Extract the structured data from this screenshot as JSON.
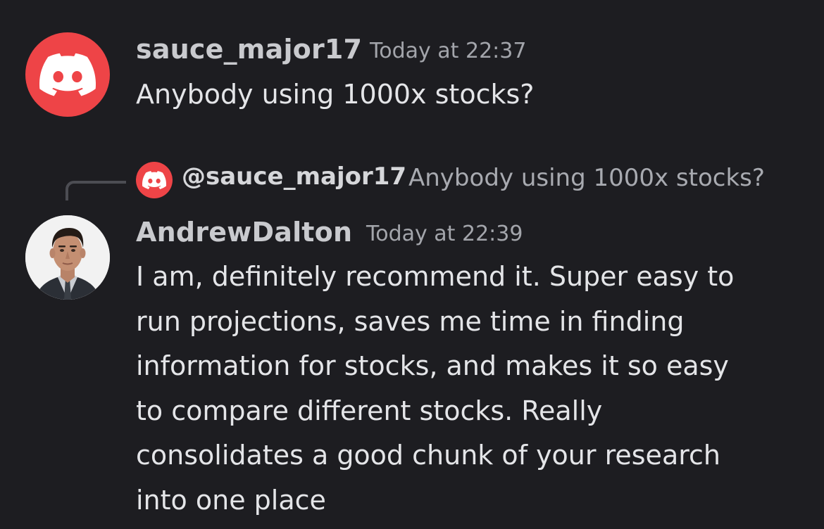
{
  "messages": [
    {
      "username": "sauce_major17",
      "timestamp": "Today at 22:37",
      "text": "Anybody using 1000x stocks?",
      "avatar_icon": "discord-logo-icon",
      "avatar_color": "#ee4447"
    },
    {
      "reply": {
        "mention": "@sauce_major17",
        "preview": "Anybody using 1000x stocks?",
        "avatar_icon": "discord-logo-icon"
      },
      "username": "AndrewDalton",
      "timestamp": "Today at 22:39",
      "avatar_icon": "user-photo-avatar",
      "lines": [
        "I am, definitely recommend it. Super easy to",
        "run projections, saves me time in finding",
        "information for stocks, and makes it so easy",
        "to compare different stocks. Really",
        "consolidates a good chunk of your research",
        "into one place"
      ]
    }
  ],
  "theme": {
    "background": "#1d1d21",
    "accent": "#ee4447"
  }
}
